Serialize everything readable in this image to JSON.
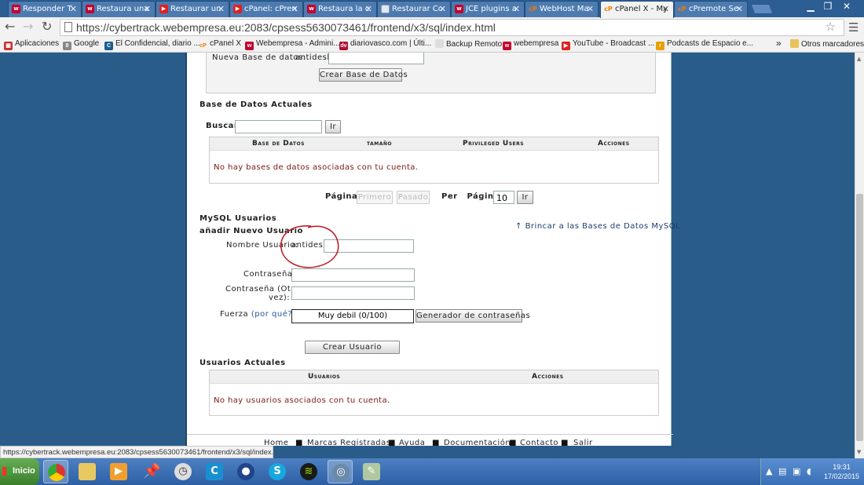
{
  "browser": {
    "tabs": [
      {
        "label": "Responder T",
        "icon": "webempresa-icon"
      },
      {
        "label": "Restaura una",
        "icon": "webempresa-icon"
      },
      {
        "label": "Restaurar un",
        "icon": "youtube-icon"
      },
      {
        "label": "cPanel: cPren",
        "icon": "youtube-icon"
      },
      {
        "label": "Restaura la c",
        "icon": "webempresa-icon"
      },
      {
        "label": "Restaurar Co",
        "icon": "document-icon"
      },
      {
        "label": "JCE plugins a",
        "icon": "webempresa-icon"
      },
      {
        "label": "WebHost Ma",
        "icon": "cpanel-icon"
      },
      {
        "label": "cPanel X - My",
        "icon": "cpanel-icon",
        "active": true
      },
      {
        "label": "cPremote Se",
        "icon": "cpanel-icon"
      }
    ],
    "url": "https://cybertrack.webempresa.eu:2083/cpsess5630073461/frontend/x3/sql/index.html",
    "bookmarks": [
      {
        "label": "Aplicaciones"
      },
      {
        "label": "Google"
      },
      {
        "label": "El Confidencial, diario ..."
      },
      {
        "label": "cPanel X"
      },
      {
        "label": "Webempresa - Admini..."
      },
      {
        "label": "diariovasco.com | Últi..."
      },
      {
        "label": "Backup Remoto"
      },
      {
        "label": "webempresa"
      },
      {
        "label": "YouTube - Broadcast ..."
      },
      {
        "label": "Podcasts de Espacio e..."
      }
    ],
    "bookmarks_more": "»",
    "other_bookmarks": "Otros marcadores",
    "status_url": "https://cybertrack.webempresa.eu:2083/cpsess5630073461/frontend/x3/sql/index.html"
  },
  "page": {
    "new_db": {
      "label": "Nueva Base de datos:",
      "prefix": "antidesl_",
      "value": "",
      "button": "Crear Base de Datos"
    },
    "current_dbs": {
      "heading": "Base de Datos Actuales",
      "search_label": "Buscar",
      "search_value": "",
      "search_button": "Ir",
      "columns": [
        "Base de Datos",
        "tamaño",
        "Privileged Users",
        "Acciones"
      ],
      "empty_message": "No hay bases de datos asociadas con tu cuenta."
    },
    "pagination": {
      "page_label": "Página:",
      "first": "Primero",
      "previous": "Pasado",
      "per_page_label": "Per   Página:",
      "per_page_value": "10",
      "go_button": "Ir"
    },
    "mysql_users": {
      "heading": "MySQL Usuarios",
      "subheading": "añadir Nuevo Usuario",
      "jump_link": "Brincar a las Bases de Datos MySQL",
      "username_label": "Nombre Usuario:",
      "username_prefix": "antidesl_",
      "username_value": "",
      "password_label": "Contraseña:",
      "password_again_label_1": "Contraseña (Otra",
      "password_again_label_2": "vez):",
      "strength_label": "Fuerza",
      "strength_why": "(por qué?)",
      "strength_colon": ":",
      "strength_value": "Muy debil (0/100)",
      "generator_button": "Generador de contraseñas",
      "create_button": "Crear Usuario"
    },
    "current_users": {
      "heading": "Usuarios Actuales",
      "columns": [
        "Usuarios",
        "Acciones"
      ],
      "empty_message": "No hay usuarios asociados con tu cuenta."
    },
    "footer": [
      "Home",
      "Marcas Registradas",
      "Ayuda",
      "Documentación",
      "Contacto",
      "Salir"
    ]
  },
  "taskbar": {
    "start_label": "Inicio",
    "time": "19:31",
    "date": "17/02/2015"
  },
  "colors": {
    "page_bg": "#2a5c8a",
    "empty_text": "#7a1a10",
    "annotation_circle": "#c0202a"
  }
}
